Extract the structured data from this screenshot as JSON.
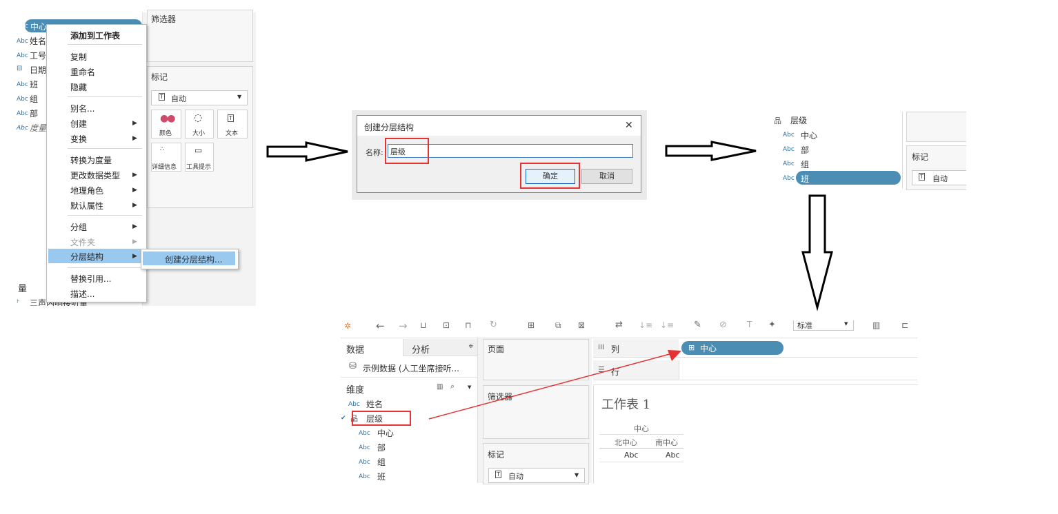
{
  "panel1": {
    "fields": [
      {
        "type": "Abc",
        "name": "中心",
        "selected": true
      },
      {
        "type": "Abc",
        "name": "姓名"
      },
      {
        "type": "Abc",
        "name": "工号"
      },
      {
        "type": "date",
        "name": "日期"
      },
      {
        "type": "Abc",
        "name": "班"
      },
      {
        "type": "Abc",
        "name": "组"
      },
      {
        "type": "Abc",
        "name": "部"
      },
      {
        "type": "Abc",
        "name": "度量"
      }
    ],
    "measures_header": "量",
    "measure_item": "三声内响接听量",
    "filters_label": "筛选器",
    "marks_label": "标记",
    "marks_type": "自动",
    "mark_buttons": [
      "颜色",
      "大小",
      "文本",
      "详细信息",
      "工具提示"
    ],
    "context_menu": [
      "添加到工作表",
      "复制",
      "重命名",
      "隐藏",
      "别名...",
      "创建",
      "变换",
      "转换为度量",
      "更改数据类型",
      "地理角色",
      "默认属性",
      "分组",
      "文件夹",
      "分层结构",
      "替换引用...",
      "描述..."
    ],
    "submenu_item": "创建分层结构..."
  },
  "dialog": {
    "title": "创建分层结构",
    "close": "✕",
    "name_label": "名称:",
    "name_value": "层级",
    "ok": "确定",
    "cancel": "取消"
  },
  "panel3": {
    "hierarchy": "层级",
    "children": [
      "中心",
      "部",
      "组",
      "班"
    ],
    "marks_label": "标记",
    "marks_type": "自动"
  },
  "panel4": {
    "tab_data": "数据",
    "tab_analysis": "分析",
    "datasource": "示例数据 (人工坐席接听...",
    "dimensions": "维度",
    "fields": [
      {
        "type": "Abc",
        "name": "姓名"
      },
      {
        "type": "hier",
        "name": "层级"
      },
      {
        "type": "Abc",
        "name": "中心",
        "indent": true
      },
      {
        "type": "Abc",
        "name": "部",
        "indent": true
      },
      {
        "type": "Abc",
        "name": "组",
        "indent": true
      },
      {
        "type": "Abc",
        "name": "班",
        "indent": true
      }
    ],
    "toolbar_dropdown": "标准",
    "pages_label": "页面",
    "filters_label": "筛选器",
    "marks_label": "标记",
    "marks_type": "自动",
    "columns_label": "列",
    "rows_label": "行",
    "column_pill": "中心",
    "sheet_title": "工作表 1",
    "table": {
      "header": "中心",
      "sub_headers": [
        "北中心",
        "南中心"
      ],
      "values": [
        "Abc",
        "Abc"
      ]
    }
  },
  "colors": {
    "pill": "#4b8db3",
    "highlight": "#99c9ef",
    "red": "#e63232",
    "abc": "#2f6f9f"
  }
}
